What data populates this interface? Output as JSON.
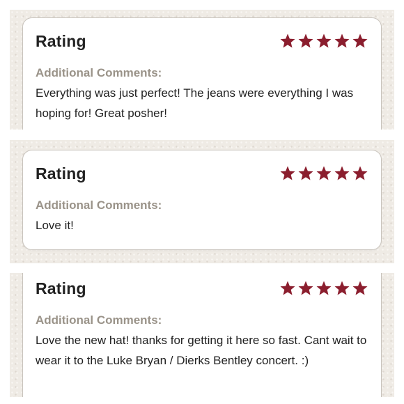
{
  "reviews": [
    {
      "rating_label": "Rating",
      "stars": 5,
      "comments_label": "Additional Comments:",
      "comment": "Everything was just perfect! The jeans were everything I was hoping for! Great posher!"
    },
    {
      "rating_label": "Rating",
      "stars": 5,
      "comments_label": "Additional Comments:",
      "comment": "Love it!"
    },
    {
      "rating_label": "Rating",
      "stars": 5,
      "comments_label": "Additional Comments:",
      "comment": "Love the new hat! thanks for getting it here so fast. Cant wait to wear it to the Luke Bryan / Dierks Bentley concert. :)"
    }
  ],
  "colors": {
    "star": "#8b1e2e",
    "panel_bg": "#efebe5",
    "label_gray": "#9a9389",
    "text": "#222222"
  },
  "icons": {
    "star": "star-icon"
  }
}
